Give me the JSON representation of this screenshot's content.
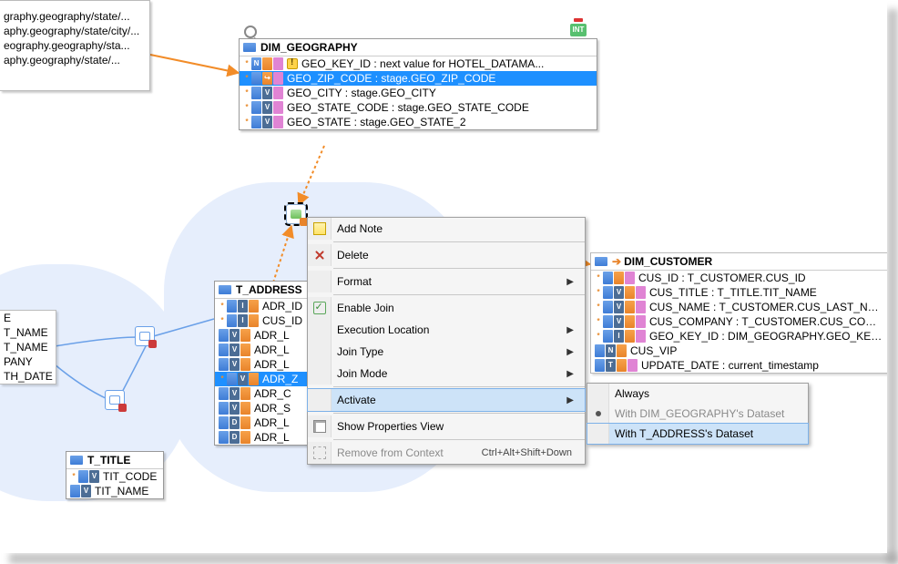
{
  "topFragment": {
    "lines": [
      "graphy.geography/state/...",
      "aphy.geography/state/city/...",
      "eography.geography/sta...",
      "aphy.geography/state/..."
    ]
  },
  "dimGeography": {
    "title": "DIM_GEOGRAPHY",
    "rows": [
      {
        "badges": [
          "*",
          "blu:N",
          "ora",
          "pk"
        ],
        "warn": true,
        "text": "GEO_KEY_ID : next value for HOTEL_DATAMA..."
      },
      {
        "badges": [
          "*",
          "blu",
          "ora:↪",
          "pk"
        ],
        "text": "GEO_ZIP_CODE : stage.GEO_ZIP_CODE",
        "selected": true
      },
      {
        "badges": [
          "*",
          "blu",
          "letter:V",
          "pk"
        ],
        "text": "GEO_CITY : stage.GEO_CITY"
      },
      {
        "badges": [
          "*",
          "blu",
          "letter:V",
          "pk"
        ],
        "text": "GEO_STATE_CODE : stage.GEO_STATE_CODE"
      },
      {
        "badges": [
          "*",
          "blu",
          "letter:V",
          "pk"
        ],
        "text": "GEO_STATE : stage.GEO_STATE_2"
      }
    ]
  },
  "tAddress": {
    "title": "T_ADDRESS",
    "rows": [
      {
        "badges": [
          "*",
          "blu",
          "letter:I",
          "ora"
        ],
        "text": "ADR_ID"
      },
      {
        "badges": [
          "*",
          "blu",
          "letter:I",
          "ora"
        ],
        "text": "CUS_ID"
      },
      {
        "badges": [
          "blu",
          "letter:V",
          "ora"
        ],
        "text": "ADR_L"
      },
      {
        "badges": [
          "blu",
          "letter:V",
          "ora"
        ],
        "text": "ADR_L"
      },
      {
        "badges": [
          "blu",
          "letter:V",
          "ora"
        ],
        "text": "ADR_L"
      },
      {
        "badges": [
          "*",
          "blu",
          "letter:V",
          "ora"
        ],
        "text": "ADR_Z",
        "selected": true
      },
      {
        "badges": [
          "blu",
          "letter:V",
          "ora"
        ],
        "text": "ADR_C"
      },
      {
        "badges": [
          "blu",
          "letter:V",
          "ora"
        ],
        "text": "ADR_S"
      },
      {
        "badges": [
          "blu",
          "letter:D",
          "ora"
        ],
        "text": "ADR_L"
      },
      {
        "badges": [
          "blu",
          "letter:D",
          "ora"
        ],
        "text": "ADR_L"
      }
    ]
  },
  "tTitle": {
    "title": "T_TITLE",
    "rows": [
      {
        "badges": [
          "*",
          "blu",
          "letter:V"
        ],
        "text": "TIT_CODE"
      },
      {
        "badges": [
          "blu",
          "letter:V"
        ],
        "text": "TIT_NAME"
      }
    ]
  },
  "leftFrag": {
    "rows": [
      "E",
      "T_NAME",
      "T_NAME",
      "PANY",
      "TH_DATE"
    ]
  },
  "dimCustomer": {
    "title": "DIM_CUSTOMER",
    "rows": [
      {
        "badges": [
          "*",
          "blu",
          "ora",
          "pk"
        ],
        "text": "CUS_ID : T_CUSTOMER.CUS_ID"
      },
      {
        "badges": [
          "*",
          "blu",
          "letter:V",
          "ora",
          "pk"
        ],
        "text": "CUS_TITLE : T_TITLE.TIT_NAME"
      },
      {
        "badges": [
          "*",
          "blu",
          "letter:V",
          "ora",
          "pk"
        ],
        "text": "CUS_NAME : T_CUSTOMER.CUS_LAST_NAME"
      },
      {
        "badges": [
          "*",
          "blu",
          "letter:V",
          "ora",
          "pk"
        ],
        "text": "CUS_COMPANY : T_CUSTOMER.CUS_COMPA"
      },
      {
        "badges": [
          "*",
          "blu",
          "letter:I",
          "ora",
          "pk"
        ],
        "text": "GEO_KEY_ID : DIM_GEOGRAPHY.GEO_KEY_ID"
      },
      {
        "badges": [
          "blu",
          "letter:N",
          "ora"
        ],
        "text": "CUS_VIP"
      },
      {
        "badges": [
          "blu",
          "letter:T",
          "ora",
          "pk"
        ],
        "text": "UPDATE_DATE : current_timestamp"
      }
    ]
  },
  "contextMenu": {
    "items": [
      {
        "icon": "note",
        "label": "Add Note"
      },
      {
        "sep": true
      },
      {
        "icon": "del",
        "label": "Delete"
      },
      {
        "sep": true
      },
      {
        "label": "Format",
        "submenu": true
      },
      {
        "sep": true
      },
      {
        "icon": "check",
        "label": "Enable Join"
      },
      {
        "label": "Execution Location",
        "submenu": true
      },
      {
        "label": "Join Type",
        "submenu": true
      },
      {
        "label": "Join Mode",
        "submenu": true
      },
      {
        "sep": true
      },
      {
        "label": "Activate",
        "submenu": true,
        "highlight": true
      },
      {
        "sep": true
      },
      {
        "icon": "prop",
        "label": "Show Properties View"
      },
      {
        "sep": true
      },
      {
        "icon": "rem",
        "label": "Remove from Context",
        "shortcut": "Ctrl+Alt+Shift+Down",
        "disabled": true
      }
    ]
  },
  "activateSubmenu": {
    "items": [
      {
        "label": "Always"
      },
      {
        "label": "With  DIM_GEOGRAPHY's Dataset",
        "disabled": true,
        "dot": true
      },
      {
        "label": "With  T_ADDRESS's Dataset",
        "highlight": true
      }
    ]
  }
}
